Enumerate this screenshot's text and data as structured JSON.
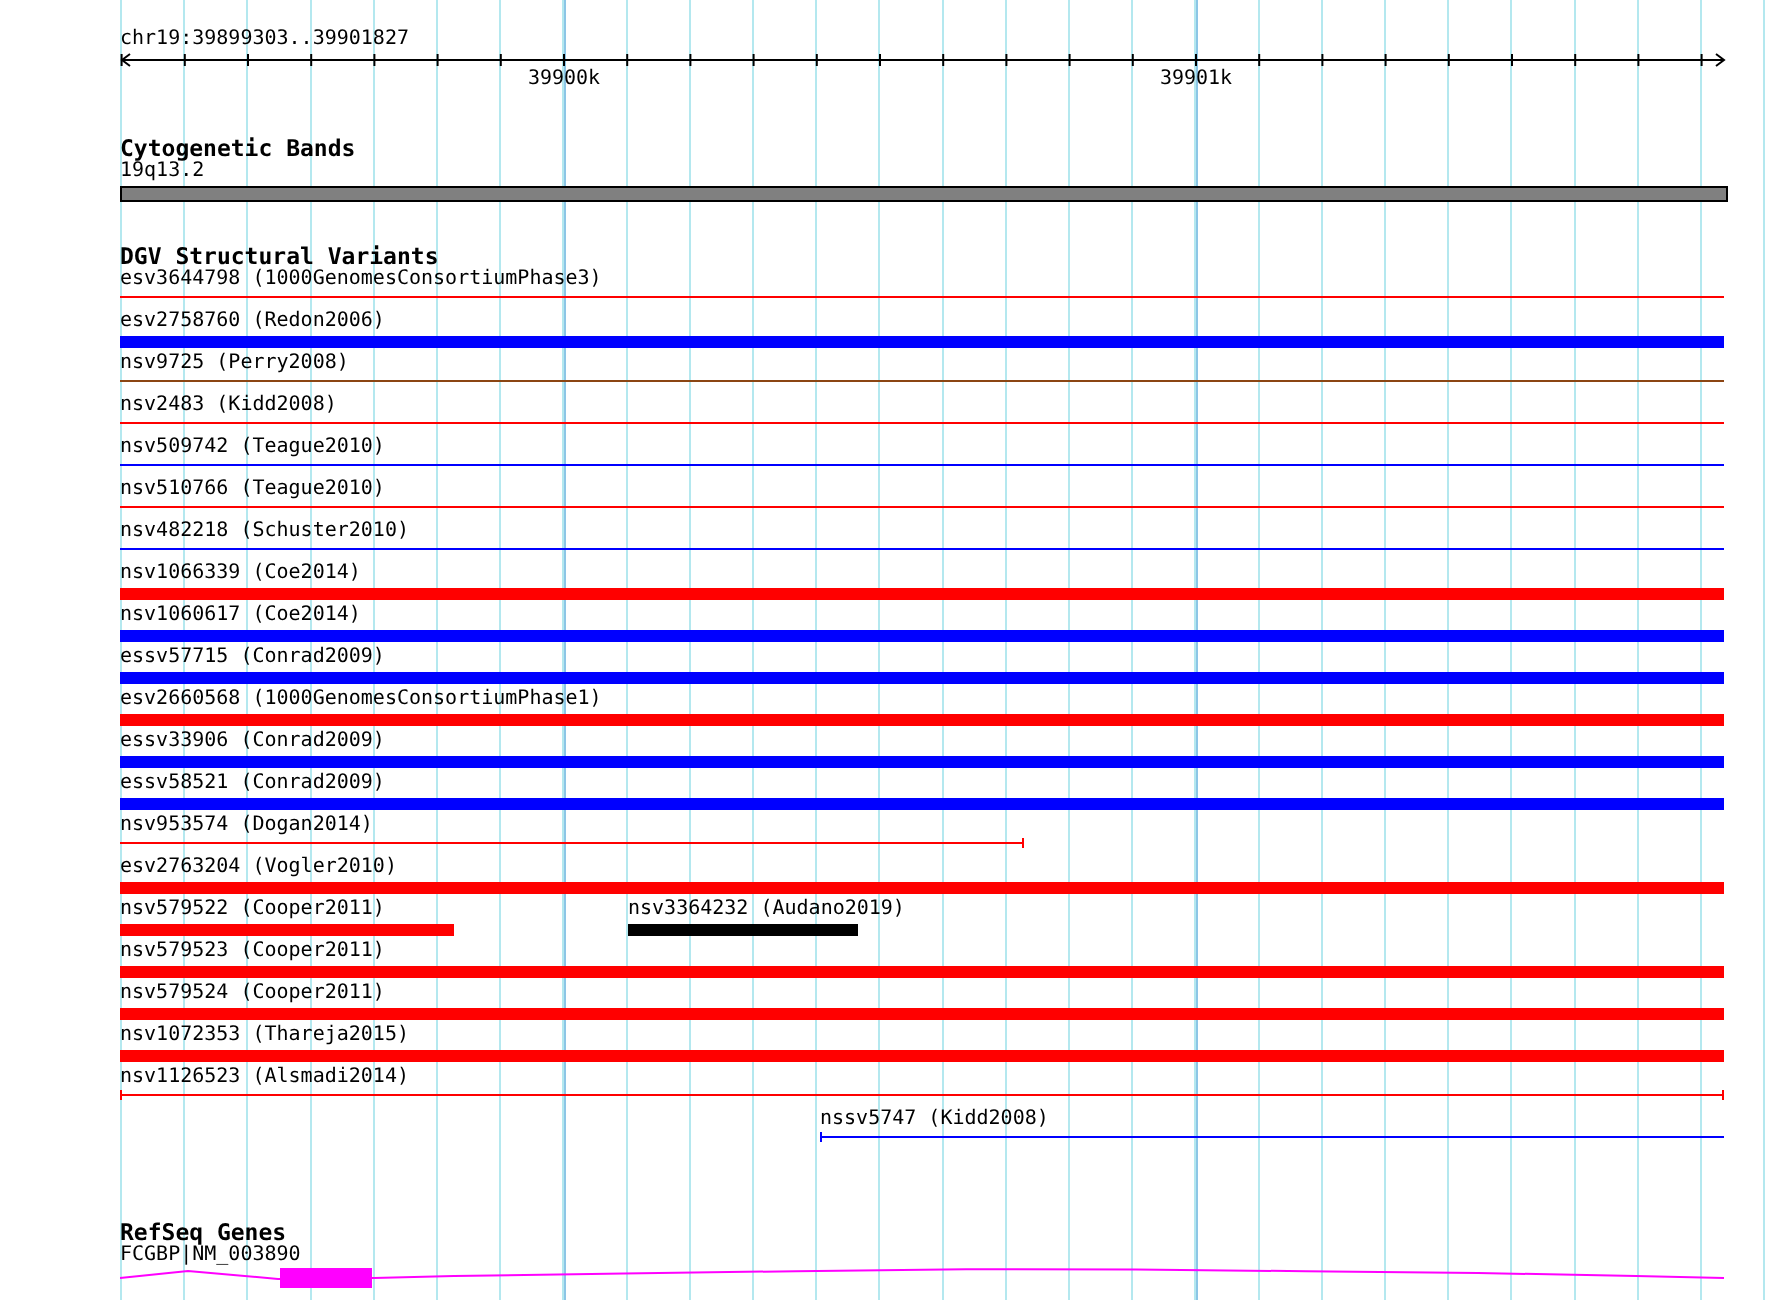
{
  "ruler": {
    "location": "chr19:39899303..39901827",
    "tick_labels": [
      "39900k",
      "39901k"
    ]
  },
  "tracks": [
    {
      "kind": "bands",
      "title": "Cytogenetic Bands",
      "label": "19q13.2"
    },
    {
      "kind": "variants",
      "title": "DGV Structural Variants",
      "rows": [
        {
          "features": [
            {
              "label": "esv3644798 (1000GenomesConsortiumPhase3)",
              "kind": "thin",
              "color": "#ff0000"
            }
          ]
        },
        {
          "features": [
            {
              "label": "esv2758760 (Redon2006)",
              "kind": "thick",
              "color": "#0000ff"
            }
          ]
        },
        {
          "features": [
            {
              "label": "nsv9725 (Perry2008)",
              "kind": "thin",
              "color": "#8b4513"
            }
          ]
        },
        {
          "features": [
            {
              "label": "nsv2483 (Kidd2008)",
              "kind": "thin",
              "color": "#ff0000"
            }
          ]
        },
        {
          "features": [
            {
              "label": "nsv509742 (Teague2010)",
              "kind": "thin",
              "color": "#0000ff"
            }
          ]
        },
        {
          "features": [
            {
              "label": "nsv510766 (Teague2010)",
              "kind": "thin",
              "color": "#ff0000"
            }
          ]
        },
        {
          "features": [
            {
              "label": "nsv482218 (Schuster2010)",
              "kind": "thin",
              "color": "#0000ff"
            }
          ]
        },
        {
          "features": [
            {
              "label": "nsv1066339 (Coe2014)",
              "kind": "thick",
              "color": "#ff0000"
            }
          ]
        },
        {
          "features": [
            {
              "label": "nsv1060617 (Coe2014)",
              "kind": "thick",
              "color": "#0000ff"
            }
          ]
        },
        {
          "features": [
            {
              "label": "essv57715 (Conrad2009)",
              "kind": "thick",
              "color": "#0000ff"
            }
          ]
        },
        {
          "features": [
            {
              "label": "esv2660568 (1000GenomesConsortiumPhase1)",
              "kind": "thick",
              "color": "#ff0000"
            }
          ]
        },
        {
          "features": [
            {
              "label": "essv33906 (Conrad2009)",
              "kind": "thick",
              "color": "#0000ff"
            }
          ]
        },
        {
          "features": [
            {
              "label": "essv58521 (Conrad2009)",
              "kind": "thick",
              "color": "#0000ff"
            }
          ]
        },
        {
          "features": [
            {
              "label": "nsv953574 (Dogan2014)",
              "kind": "thin",
              "color": "#ff0000"
            }
          ]
        },
        {
          "features": [
            {
              "label": "esv2763204 (Vogler2010)",
              "kind": "thick",
              "color": "#ff0000"
            }
          ]
        },
        {
          "features": [
            {
              "label": "nsv579522 (Cooper2011)",
              "kind": "thick",
              "color": "#ff0000"
            },
            {
              "label": "nsv3364232 (Audano2019)",
              "kind": "thick",
              "color": "#000000"
            }
          ]
        },
        {
          "features": [
            {
              "label": "nsv579523 (Cooper2011)",
              "kind": "thick",
              "color": "#ff0000"
            }
          ]
        },
        {
          "features": [
            {
              "label": "nsv579524 (Cooper2011)",
              "kind": "thick",
              "color": "#ff0000"
            }
          ]
        },
        {
          "features": [
            {
              "label": "nsv1072353 (Thareja2015)",
              "kind": "thick",
              "color": "#ff0000"
            }
          ]
        },
        {
          "features": [
            {
              "label": "nsv1126523 (Alsmadi2014)",
              "kind": "thin",
              "color": "#ff0000"
            }
          ]
        },
        {
          "features": [
            {
              "label": "nssv5747 (Kidd2008)",
              "kind": "thin",
              "color": "#0000ff"
            }
          ]
        }
      ]
    },
    {
      "kind": "genes",
      "title": "RefSeq Genes",
      "label": "FCGBP|NM_003890"
    }
  ]
}
